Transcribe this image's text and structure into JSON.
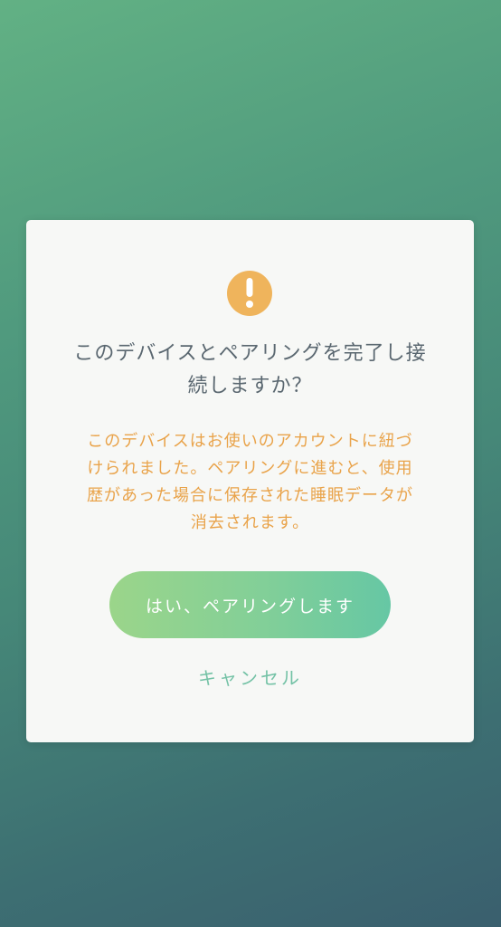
{
  "dialog": {
    "icon": "exclamation-icon",
    "icon_color": "#efb45c",
    "title_line1": "このデバイスとペアリングを完了し接",
    "title_line2": "続しますか？",
    "message_line1": "このデバイスはお使いのアカウントに紐づ",
    "message_line2": "けられました。ペアリングに進むと、使用",
    "message_line3": "歴があった場合に保存された睡眠データが",
    "message_line4": "消去されます。",
    "confirm_label": "はい、ペアリングします",
    "cancel_label": "キャンセル"
  },
  "colors": {
    "title": "#5a6770",
    "message": "#e9a34a",
    "accent": "#74c2a6"
  }
}
